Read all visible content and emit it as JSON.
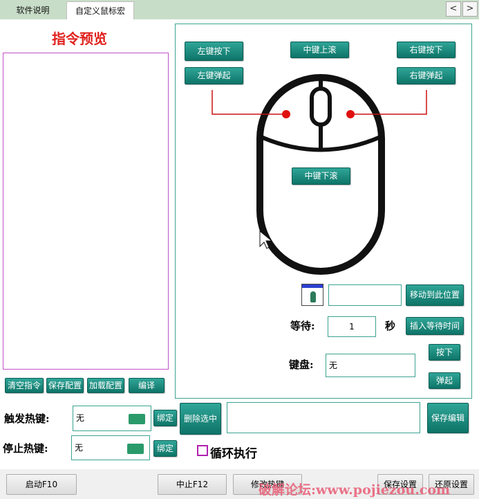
{
  "tabs": [
    {
      "label": "软件说明"
    },
    {
      "label": "自定义鼠标宏"
    }
  ],
  "nav": {
    "prev": "<",
    "next": ">"
  },
  "preview": {
    "title": "指令预览"
  },
  "left_buttons": {
    "clear": "清空指令",
    "save_config": "保存配置",
    "load_config": "加载配置",
    "compile": "编译"
  },
  "mouse_buttons": {
    "left_down": "左键按下",
    "left_up": "左键弹起",
    "middle_up": "中键上滚",
    "right_down": "右键按下",
    "right_up": "右键弹起",
    "middle_down": "中键下滚"
  },
  "move": {
    "button": "移动到此位置",
    "value": ""
  },
  "wait": {
    "label": "等待:",
    "value": "1",
    "unit": "秒",
    "button": "插入等待时间"
  },
  "keyboard": {
    "label": "键盘:",
    "value": "无",
    "press": "按下",
    "release": "弹起"
  },
  "trigger": {
    "label": "触发热键:",
    "value": "无",
    "bind": "绑定"
  },
  "stop": {
    "label": "停止热键:",
    "value": "无",
    "bind": "绑定"
  },
  "delete_selected": "删除选中",
  "save_edit": "保存编辑",
  "edit_value": "",
  "loop": {
    "label": "循环执行",
    "checked": false
  },
  "bottom": {
    "start": "启动F10",
    "stop": "中止F12",
    "modify": "修改热键",
    "save": "保存设置",
    "restore": "还原设置"
  },
  "watermark": "破解论坛:www.pojiezou.com"
}
